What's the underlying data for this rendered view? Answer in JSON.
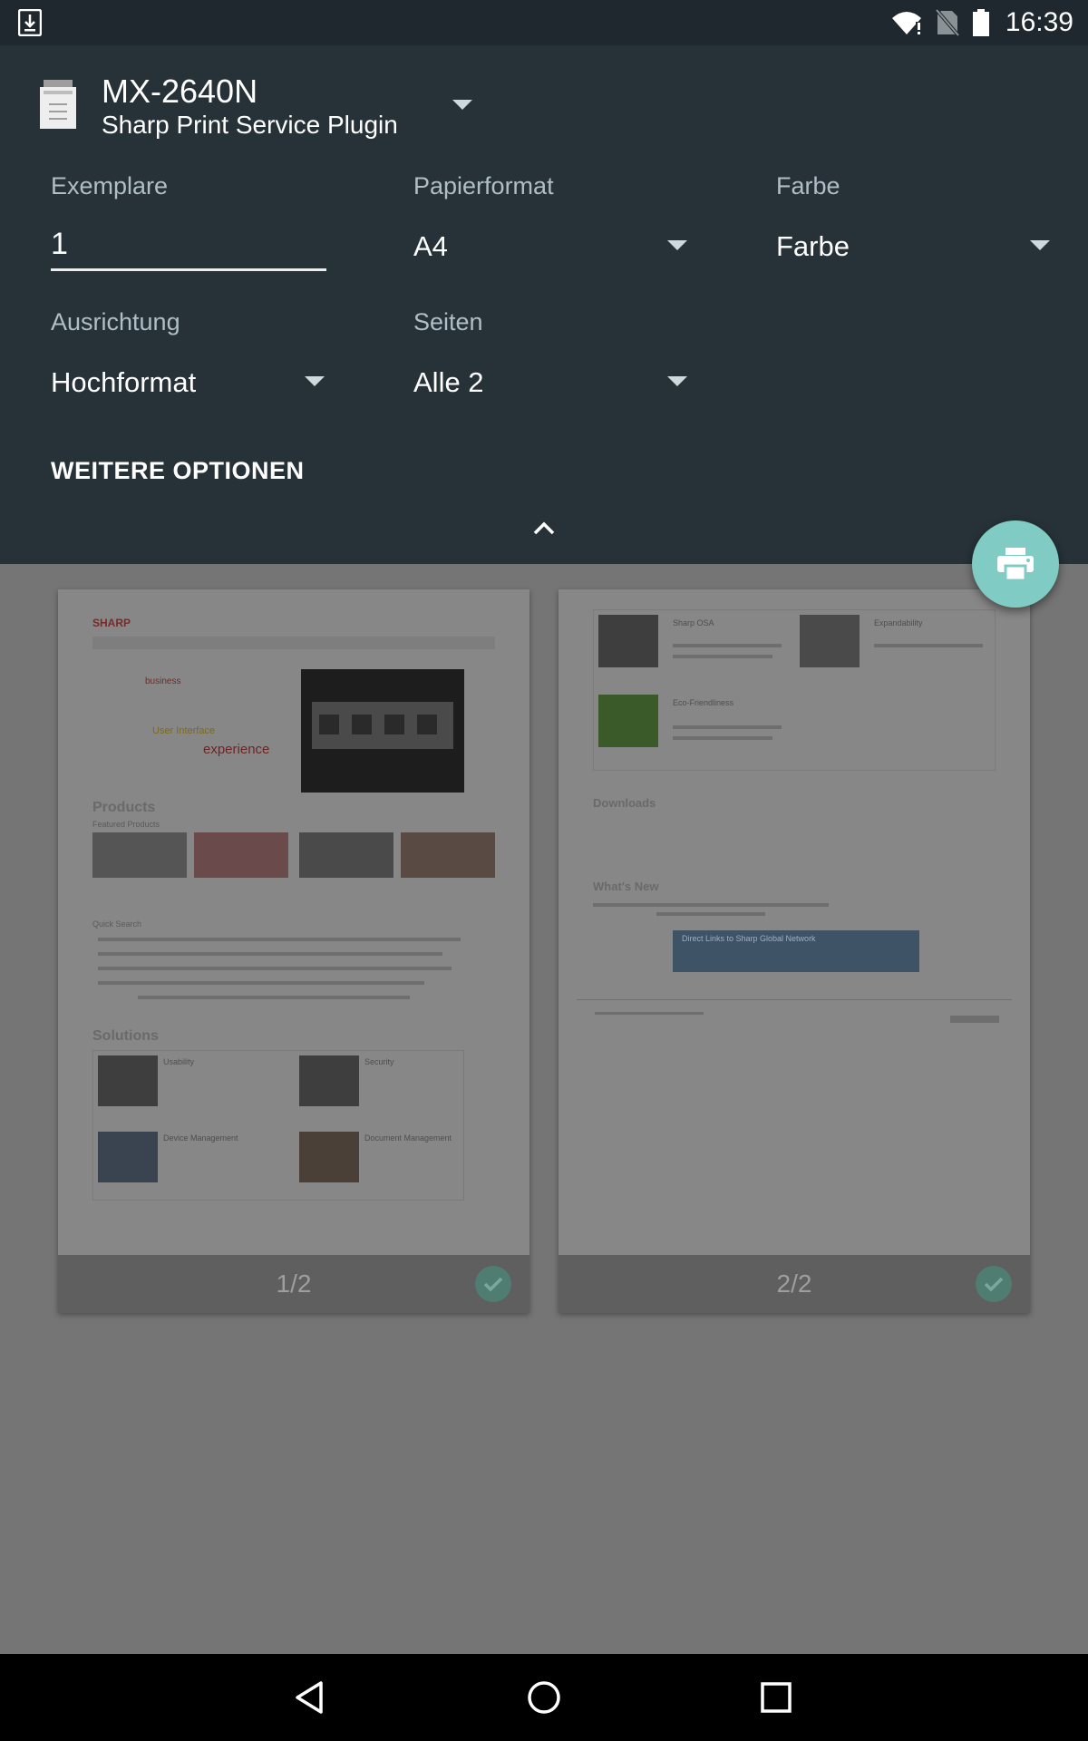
{
  "status_bar": {
    "time": "16:39",
    "icons": [
      "download-icon",
      "wifi-icon",
      "no-sim-icon",
      "battery-icon"
    ]
  },
  "printer": {
    "name": "MX-2640N",
    "service": "Sharp Print Service Plugin"
  },
  "options": {
    "copies": {
      "label": "Exemplare",
      "value": "1"
    },
    "paper_size": {
      "label": "Papierformat",
      "value": "A4"
    },
    "color": {
      "label": "Farbe",
      "value": "Farbe"
    },
    "orientation": {
      "label": "Ausrichtung",
      "value": "Hochformat"
    },
    "pages": {
      "label": "Seiten",
      "value": "Alle 2"
    },
    "more_options": "WEITERE OPTIONEN"
  },
  "preview": {
    "pages": [
      {
        "label": "1/2",
        "selected": true
      },
      {
        "label": "2/2",
        "selected": true
      }
    ],
    "page1": {
      "logo": "SHARP",
      "hero_line1": "business",
      "hero_line2": "User Interface",
      "hero_line3": "experience",
      "products_heading": "Products",
      "featured_label": "Featured Products",
      "quick_search": "Quick Search",
      "solutions_heading": "Solutions",
      "solutions": [
        "Usability",
        "Security",
        "Device Management",
        "Document Management"
      ]
    },
    "page2": {
      "cells": [
        "Sharp OSA",
        "Expandability",
        "Eco-Friendliness"
      ],
      "downloads_heading": "Downloads",
      "whats_new_heading": "What's New",
      "banner": "Direct Links to Sharp Global Network"
    }
  },
  "colors": {
    "panel_bg": "#263238",
    "status_bar_bg": "#1e282e",
    "fab": "#80cbc4",
    "label": "#b0bec5"
  }
}
